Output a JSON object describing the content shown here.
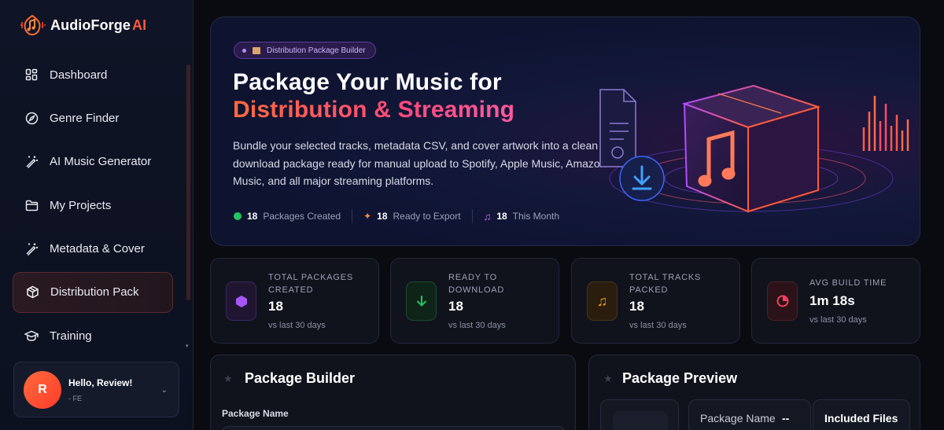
{
  "app": {
    "name": "AudioForge",
    "name_suffix": "AI"
  },
  "sidebar": {
    "items": [
      {
        "label": "Dashboard",
        "icon": "grid-icon"
      },
      {
        "label": "Genre Finder",
        "icon": "compass-icon"
      },
      {
        "label": "AI Music Generator",
        "icon": "magic-wand-icon"
      },
      {
        "label": "My Projects",
        "icon": "folder-icon"
      },
      {
        "label": "Metadata & Cover",
        "icon": "magic-wand-icon"
      },
      {
        "label": "Distribution Pack",
        "icon": "package-icon",
        "active": true
      },
      {
        "label": "Training",
        "icon": "graduation-cap-icon"
      }
    ],
    "user": {
      "initial": "R",
      "greeting": "Hello, Review!",
      "role": "- FE"
    }
  },
  "hero": {
    "badge": "Distribution Package Builder",
    "title_line1": "Package Your Music for",
    "title_line2": "Distribution & Streaming",
    "description": "Bundle your selected tracks, metadata CSV, and cover artwork into a clean download package ready for manual upload to Spotify, Apple Music, Amazon Music, and all major streaming platforms.",
    "stats": [
      {
        "value": "18",
        "label": "Packages Created",
        "icon": "green-dot-icon"
      },
      {
        "value": "18",
        "label": "Ready to Export",
        "icon": "sparkle-icon"
      },
      {
        "value": "18",
        "label": "This Month",
        "icon": "music-note-icon"
      }
    ]
  },
  "stat_cards": [
    {
      "label_line1": "TOTAL PACKAGES",
      "label_line2": "CREATED",
      "value": "18",
      "sub": "vs last 30 days",
      "icon": "hexagon-icon",
      "color": "#a855f7"
    },
    {
      "label_line1": "READY TO",
      "label_line2": "DOWNLOAD",
      "value": "18",
      "sub": "vs last 30 days",
      "icon": "download-arrow-icon",
      "color": "#22c55e"
    },
    {
      "label_line1": "TOTAL TRACKS",
      "label_line2": "PACKED",
      "value": "18",
      "sub": "vs last 30 days",
      "icon": "music-note-icon",
      "color": "#f59e0b"
    },
    {
      "label_line1": "AVG BUILD TIME",
      "label_line2": "",
      "value": "1m 18s",
      "sub": "vs last 30 days",
      "icon": "pie-clock-icon",
      "color": "#f43f5e"
    }
  ],
  "package_builder": {
    "title": "Package Builder",
    "field_label": "Package Name"
  },
  "package_preview": {
    "title": "Package Preview",
    "name_label": "Package Name",
    "name_value": "--",
    "included_label": "Included Files"
  },
  "colors": {
    "accent": "#ff5a3c",
    "background": "#0a0b10",
    "sidebar": "#0f1426"
  }
}
